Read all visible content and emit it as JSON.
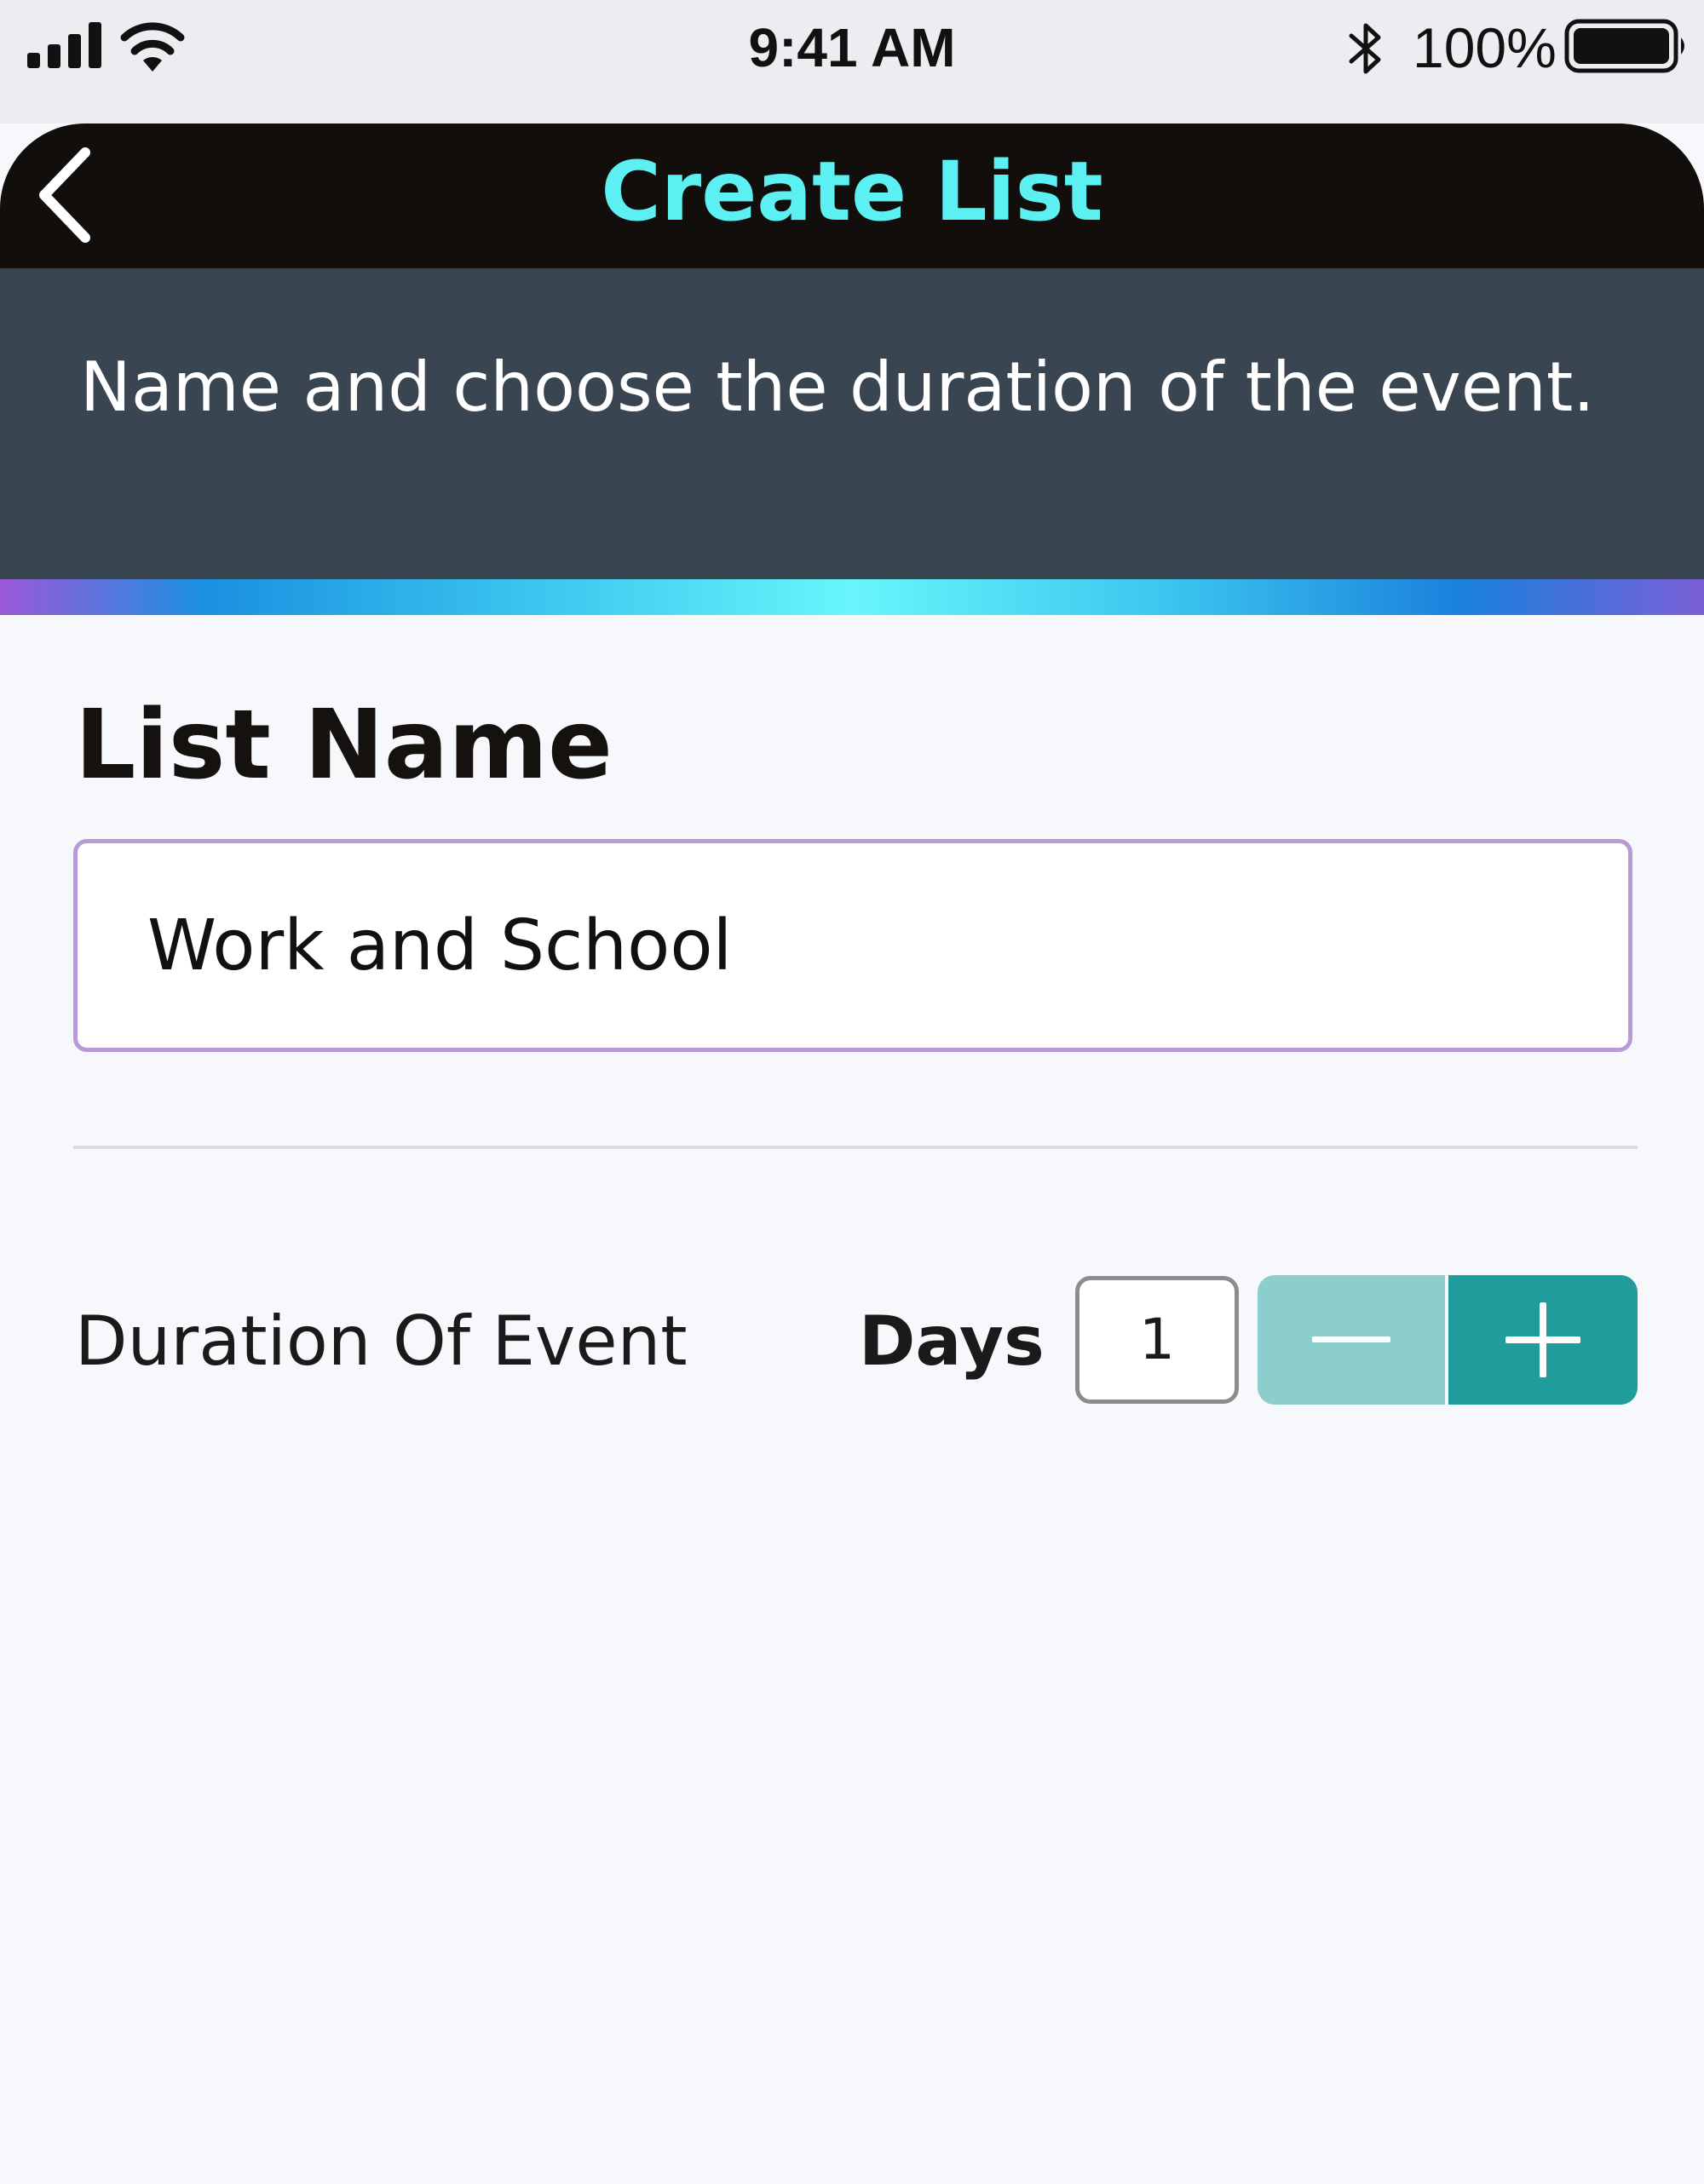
{
  "status_bar": {
    "time": "9:41 AM",
    "battery_percent": "100%",
    "icons": [
      "signal-icon",
      "wifi-icon",
      "bluetooth-icon",
      "battery-icon"
    ]
  },
  "nav": {
    "title": "Create List",
    "back_icon": "chevron-left-icon"
  },
  "banner": {
    "text": "Name and choose the duration of the event."
  },
  "form": {
    "section_title": "List Name",
    "list_name_value": "Work and School",
    "duration_label": "Duration Of Event",
    "unit_label": "Days",
    "days_value": "1",
    "decrement_icon": "minus-icon",
    "increment_icon": "plus-icon"
  },
  "colors": {
    "nav_background": "#110e0b",
    "nav_title": "#5df0f2",
    "banner_background": "#3a4552",
    "input_border": "#b79ad6",
    "stepper_minus": "#8ccdcd",
    "stepper_plus": "#1f9c9b"
  }
}
